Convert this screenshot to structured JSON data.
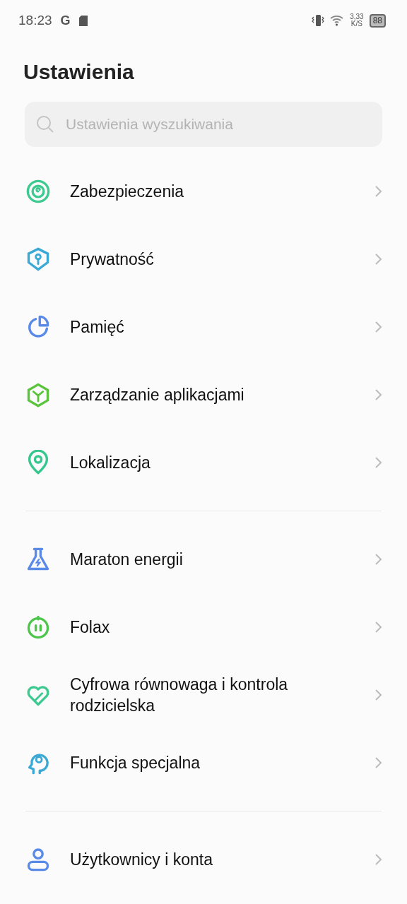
{
  "status_bar": {
    "time": "18:23",
    "g_glyph": "G",
    "speed": "3,33",
    "speed_unit": "K/S",
    "battery": "88"
  },
  "title": "Ustawienia",
  "search": {
    "placeholder": "Ustawienia wyszukiwania"
  },
  "groups": [
    {
      "items": [
        {
          "kind": "security",
          "label": "Zabezpieczenia"
        },
        {
          "kind": "privacy",
          "label": "Prywatność"
        },
        {
          "kind": "storage",
          "label": "Pamięć"
        },
        {
          "kind": "apps",
          "label": "Zarządzanie aplikacjami"
        },
        {
          "kind": "location",
          "label": "Lokalizacja"
        }
      ]
    },
    {
      "items": [
        {
          "kind": "battery",
          "label": "Maraton energii"
        },
        {
          "kind": "folax",
          "label": "Folax"
        },
        {
          "kind": "wellbeing",
          "label": "Cyfrowa równowaga i kontrola rodzicielska"
        },
        {
          "kind": "accessibility",
          "label": "Funkcja specjalna"
        }
      ]
    },
    {
      "items": [
        {
          "kind": "users",
          "label": "Użytkownicy i konta"
        }
      ]
    }
  ]
}
